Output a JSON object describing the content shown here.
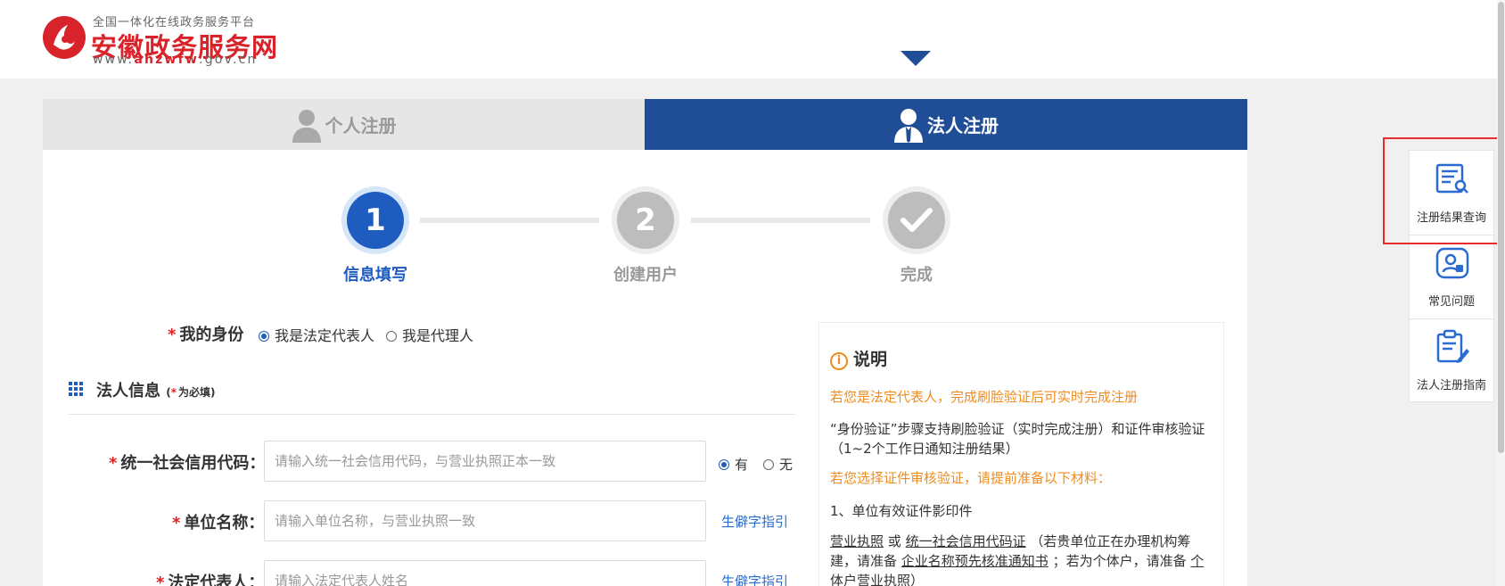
{
  "header": {
    "logo_sub": "全国一体化在线政务服务平台",
    "logo_title": "安徽政务服务网",
    "logo_url_prefix": "www.",
    "logo_url_brand": "ahzwfw",
    "logo_url_suffix": ".gov.cn"
  },
  "tabs": {
    "personal": "个人注册",
    "legal": "法人注册"
  },
  "steps": [
    {
      "number": "1",
      "label": "信息填写"
    },
    {
      "number": "2",
      "label": "创建用户"
    },
    {
      "number": "✔",
      "label": "完成"
    }
  ],
  "identity": {
    "label": "我的身份",
    "option_legal_rep": "我是法定代表人",
    "option_agent": "我是代理人",
    "selected": "我是法定代表人"
  },
  "section": {
    "title": "法人信息",
    "note_prefix": "(",
    "note_star": "*",
    "note_text": "为必填)"
  },
  "form": {
    "credit_code": {
      "label": "统一社会信用代码：",
      "placeholder": "请输入统一社会信用代码，与营业执照正本一致",
      "option_yes": "有",
      "option_no": "无",
      "selected": "有"
    },
    "unit_name": {
      "label": "单位名称：",
      "placeholder": "请输入单位名称，与营业执照一致",
      "link": "生僻字指引"
    },
    "legal_rep": {
      "label": "法定代表人：",
      "placeholder": "请输入法定代表人姓名",
      "link": "生僻字指引"
    }
  },
  "note": {
    "title": "说明",
    "line1": "若您是法定代表人，完成刷脸验证后可实时完成注册",
    "line2": "“身份验证”步骤支持刷脸验证（实时完成注册）和证件审核验证（1~2个工作日通知注册结果）",
    "line3": "若您选择证件审核验证，请提前准备以下材料：",
    "line4": "1、单位有效证件影印件",
    "doc1": "营业执照",
    "or": "或",
    "doc2": "统一社会信用代码证",
    "mid1": "（若贵单位正在办理机构筹建，请准备",
    "doc3": "企业名称预先核准通知书",
    "mid2": "；若为个体户，请准备",
    "doc4": "个体户营业执照",
    "end": "）"
  },
  "sidebar": {
    "items": [
      {
        "label": "注册结果查询",
        "icon": "document-search-icon"
      },
      {
        "label": "常见问题",
        "icon": "user-question-icon"
      },
      {
        "label": "法人注册指南",
        "icon": "clipboard-edit-icon"
      }
    ]
  },
  "colors": {
    "brand_blue": "#1f4e96",
    "step_blue": "#1f5cbf",
    "logo_red": "#d9232b",
    "note_orange": "#f08c1e",
    "highlight_red": "#e62c2c"
  }
}
